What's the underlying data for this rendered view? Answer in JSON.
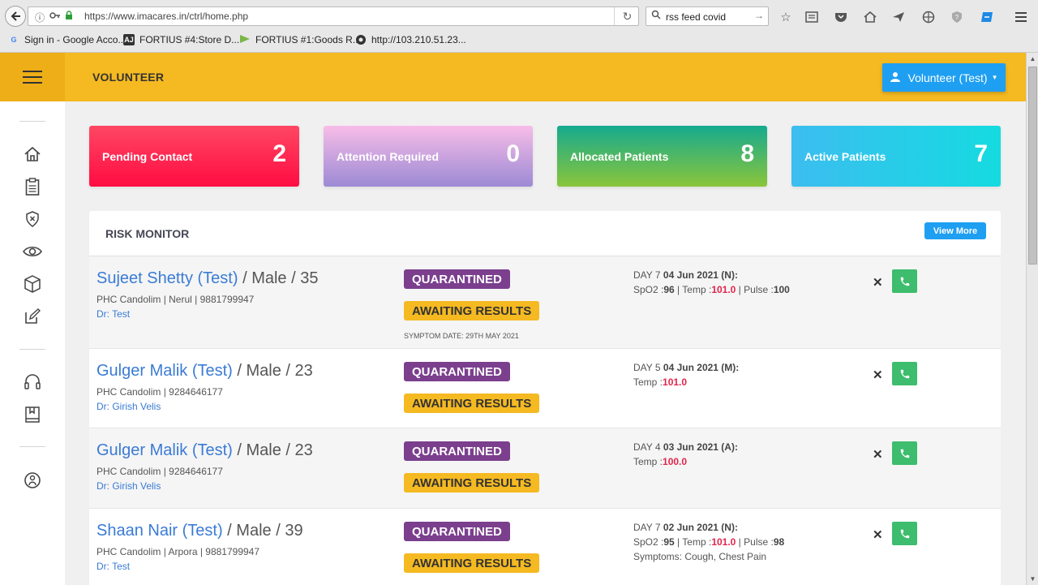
{
  "browser": {
    "url": "https://www.imacares.in/ctrl/home.php",
    "search_value": "rss feed covid",
    "bookmarks": [
      {
        "label": "Sign in - Google Acco...",
        "icon": "G",
        "icon_color": "#4285f4"
      },
      {
        "label": "FORTIUS #4:Store D...",
        "icon": "AJ",
        "icon_color": "#333333"
      },
      {
        "label": "FORTIUS #1:Goods R...",
        "icon": "",
        "icon_color": "#7ab648"
      },
      {
        "label": "http://103.210.51.23...",
        "icon": "",
        "icon_color": "#333333"
      }
    ]
  },
  "header": {
    "title": "VOLUNTEER",
    "user_label": "Volunteer (Test)"
  },
  "cards": [
    {
      "label": "Pending Contact",
      "value": "2"
    },
    {
      "label": "Attention Required",
      "value": "0"
    },
    {
      "label": "Allocated Patients",
      "value": "8"
    },
    {
      "label": "Active Patients",
      "value": "7"
    }
  ],
  "panel": {
    "title": "RISK MONITOR",
    "view_more_label": "View More"
  },
  "patients": [
    {
      "name": "Sujeet Shetty (Test)",
      "demo": " / Male / 35",
      "info": "PHC Candolim | Nerul | 9881799947",
      "doctor": "Dr: Test",
      "status1": "QUARANTINED",
      "status2": "AWAITING RESULTS",
      "symptom_date": "SYMPTOM DATE: 29TH MAY 2021",
      "day_prefix": "DAY 7 ",
      "day_date": "04 Jun 2021 (N):",
      "vitals": [
        {
          "label": "SpO2 :",
          "value": "96",
          "alert": false
        },
        {
          "label": "Temp :",
          "value": "101.0",
          "alert": true
        },
        {
          "label": "Pulse :",
          "value": "100",
          "alert": false
        }
      ],
      "symptoms": ""
    },
    {
      "name": "Gulger Malik (Test)",
      "demo": " / Male / 23",
      "info": "PHC Candolim | 9284646177",
      "doctor": "Dr: Girish Velis",
      "status1": "QUARANTINED",
      "status2": "AWAITING RESULTS",
      "symptom_date": "",
      "day_prefix": "DAY 5 ",
      "day_date": "04 Jun 2021 (M):",
      "vitals": [
        {
          "label": "Temp :",
          "value": "101.0",
          "alert": true
        }
      ],
      "symptoms": ""
    },
    {
      "name": "Gulger Malik (Test)",
      "demo": " / Male / 23",
      "info": "PHC Candolim | 9284646177",
      "doctor": "Dr: Girish Velis",
      "status1": "QUARANTINED",
      "status2": "AWAITING RESULTS",
      "symptom_date": "",
      "day_prefix": "DAY 4 ",
      "day_date": "03 Jun 2021 (A):",
      "vitals": [
        {
          "label": "Temp :",
          "value": "100.0",
          "alert": true
        }
      ],
      "symptoms": ""
    },
    {
      "name": "Shaan Nair (Test)",
      "demo": " / Male / 39",
      "info": "PHC Candolim | Arpora | 9881799947",
      "doctor": "Dr: Test",
      "status1": "QUARANTINED",
      "status2": "AWAITING RESULTS",
      "symptom_date": "",
      "day_prefix": "DAY 7 ",
      "day_date": "02 Jun 2021 (N):",
      "vitals": [
        {
          "label": "SpO2 :",
          "value": "95",
          "alert": false
        },
        {
          "label": "Temp :",
          "value": "101.0",
          "alert": true
        },
        {
          "label": "Pulse :",
          "value": "98",
          "alert": false
        }
      ],
      "symptoms": "Symptoms: Cough, Chest Pain"
    }
  ],
  "colors": {
    "brand_yellow": "#f5b921",
    "accent_blue": "#1e9ff2",
    "quarantined": "#7b3f8e",
    "call_green": "#3dbd6d",
    "alert_red": "#e0254c"
  }
}
